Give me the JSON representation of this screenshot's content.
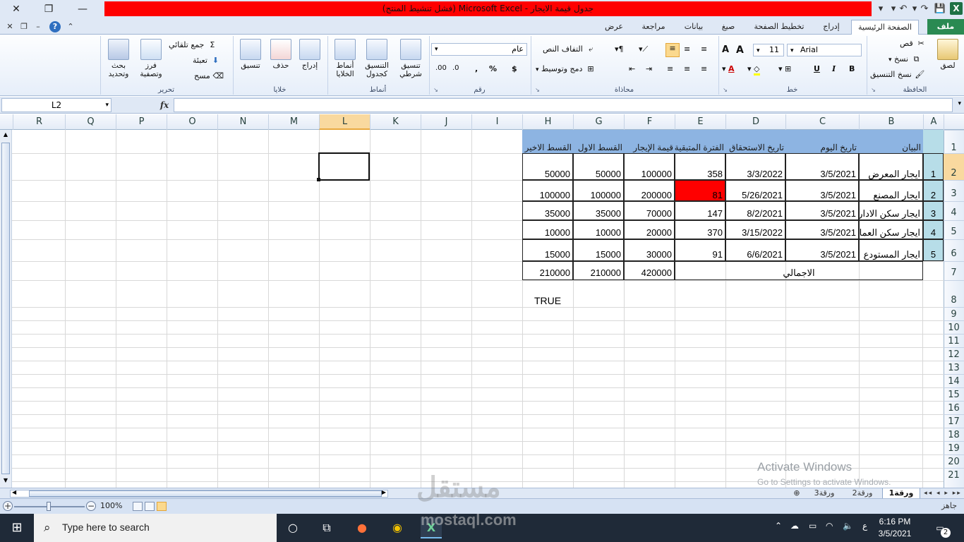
{
  "window": {
    "title": "جدول قيمة الايجار  -  Microsoft Excel (فشل تنشيط المنتج)",
    "accent": "#1e7145",
    "title_highlight": "#ff0000"
  },
  "ribbon_tabs": {
    "file": "ملف",
    "home": "الصفحة الرئيسية",
    "insert": "إدراج",
    "page_layout": "تخطيط الصفحة",
    "formulas": "صيغ",
    "data": "بيانات",
    "review": "مراجعة",
    "view": "عرض"
  },
  "ribbon": {
    "clipboard": {
      "label": "الحافظة",
      "paste": "لصق",
      "cut": "قص",
      "copy": "نسخ",
      "format_painter": "نسخ التنسيق"
    },
    "font": {
      "label": "خط",
      "name": "Arial",
      "size": "11",
      "bold": "B",
      "italic": "I",
      "underline": "U",
      "grow": "A",
      "shrink": "A"
    },
    "alignment": {
      "label": "محاذاة",
      "wrap": "التفاف النص",
      "merge": "دمج وتوسيط"
    },
    "number": {
      "label": "رقم",
      "format": "عام",
      "currency": "$",
      "percent": "%",
      "comma": ","
    },
    "styles": {
      "label": "أنماط",
      "conditional": "تنسيق\nشرطي",
      "as_table": "التنسيق\nكجدول",
      "cell_styles": "أنماط\nالخلايا"
    },
    "cells": {
      "label": "خلايا",
      "insert": "إدراج",
      "delete": "حذف",
      "format": "تنسيق"
    },
    "editing": {
      "label": "تحرير",
      "autosum": "جمع تلقائي",
      "fill": "تعبئة",
      "clear": "مسح",
      "sort": "فرز\nوتصفية",
      "find": "بحث\nوتحديد"
    }
  },
  "formula_bar": {
    "name_box": "L2",
    "fx": "fx",
    "content": ""
  },
  "columns": [
    "A",
    "B",
    "C",
    "D",
    "E",
    "F",
    "G",
    "H",
    "I",
    "J",
    "K",
    "L",
    "M",
    "N",
    "O",
    "P",
    "Q",
    "R"
  ],
  "rows": [
    "1",
    "2",
    "3",
    "4",
    "5",
    "6",
    "7",
    "8",
    "9",
    "10",
    "11",
    "12",
    "13",
    "14",
    "15",
    "16",
    "17",
    "18",
    "19",
    "20",
    "21"
  ],
  "table": {
    "headers": {
      "B": "البيان",
      "C": "تاريخ اليوم",
      "D": "تاريخ الاستحقاق",
      "E": "الفترة المتبقية",
      "F": "قيمة الإيجار",
      "G": "القسط الاول",
      "H": "القسط الاخير"
    },
    "rows": [
      {
        "A": "1",
        "B": "ايجار المعرض",
        "C": "3/5/2021",
        "D": "3/3/2022",
        "E": "358",
        "F": "100000",
        "G": "50000",
        "H": "50000"
      },
      {
        "A": "2",
        "B": "ايجار المصنع",
        "C": "3/5/2021",
        "D": "5/26/2021",
        "E": "81",
        "F": "200000",
        "G": "100000",
        "H": "100000"
      },
      {
        "A": "3",
        "B": "ايجار سكن الادارة",
        "C": "3/5/2021",
        "D": "8/2/2021",
        "E": "147",
        "F": "70000",
        "G": "35000",
        "H": "35000"
      },
      {
        "A": "4",
        "B": "ايجار سكن العمال",
        "C": "3/5/2021",
        "D": "3/15/2022",
        "E": "370",
        "F": "20000",
        "G": "10000",
        "H": "10000"
      },
      {
        "A": "5",
        "B": "ايجار المستودع",
        "C": "3/5/2021",
        "D": "6/6/2021",
        "E": "91",
        "F": "30000",
        "G": "15000",
        "H": "15000"
      }
    ],
    "total": {
      "label": "الاجمالي",
      "F": "420000",
      "G": "210000",
      "H": "210000"
    },
    "h8": "TRUE",
    "header_color": "#8db4e2",
    "index_color": "#b7dde8",
    "alert_color": "#ff0000"
  },
  "watermark": {
    "line1": "Activate Windows",
    "line2": "Go to Settings to activate Windows.",
    "site_ar": "مستقل",
    "site_url": "mostaql.com"
  },
  "sheet_tabs": [
    "ورقة1",
    "ورقة2",
    "ورقة3"
  ],
  "status": {
    "ready": "جاهز",
    "zoom": "100%",
    "zoom_fraction": 0.5
  },
  "taskbar": {
    "search_placeholder": "Type here to search",
    "time": "6:16 PM",
    "date": "3/5/2021",
    "notifications": "2",
    "lang": "ع"
  }
}
